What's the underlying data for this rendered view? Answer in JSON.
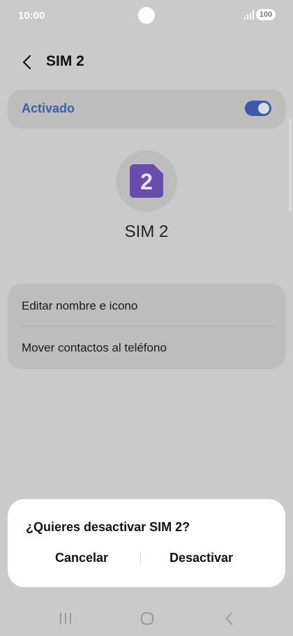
{
  "status_bar": {
    "time": "10:00",
    "battery": "100"
  },
  "header": {
    "title": "SIM 2"
  },
  "toggle": {
    "label": "Activado",
    "on": true
  },
  "sim": {
    "badge": "2",
    "name": "SIM 2"
  },
  "options": [
    {
      "label": "Editar nombre e icono"
    },
    {
      "label": "Mover contactos al teléfono"
    }
  ],
  "dialog": {
    "title": "¿Quieres desactivar SIM 2?",
    "cancel_label": "Cancelar",
    "confirm_label": "Desactivar"
  },
  "colors": {
    "accent": "#3d5ba9",
    "sim_icon": "#6a4caf",
    "scrim_background": "#cacaca"
  }
}
